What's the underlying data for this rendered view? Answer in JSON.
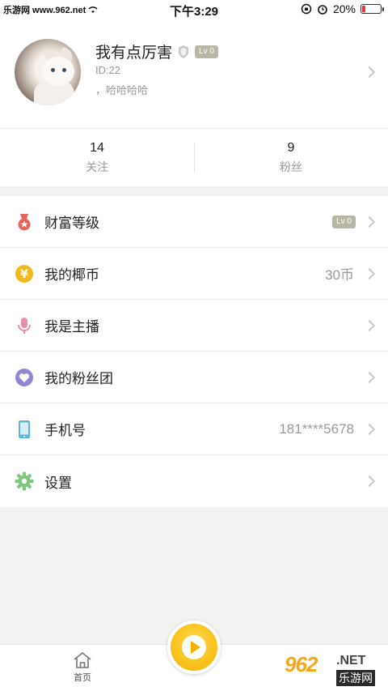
{
  "status_bar": {
    "carrier": "乐游网 www.962.net",
    "time": "下午3:29",
    "battery": "20%",
    "battery_level": 0.2
  },
  "profile": {
    "nickname": "我有点厉害",
    "level_badge": "Lv 0",
    "user_id": "ID:22",
    "signature": "，哈哈哈哈"
  },
  "stats": [
    {
      "value": "14",
      "label": "关注"
    },
    {
      "value": "9",
      "label": "粉丝"
    }
  ],
  "menu": [
    {
      "label": "财富等级",
      "badge": "Lv 0",
      "icon": "medal-icon",
      "color": "#e8645a"
    },
    {
      "label": "我的椰币",
      "value": "30币",
      "icon": "coin-icon",
      "color": "#f2b91c"
    },
    {
      "label": "我是主播",
      "icon": "microphone-icon",
      "color": "#e98fa8"
    },
    {
      "label": "我的粉丝团",
      "icon": "heart-icon",
      "color": "#8f86d6"
    },
    {
      "label": "手机号",
      "value": "181****5678",
      "icon": "phone-icon",
      "color": "#5ab7d8"
    },
    {
      "label": "设置",
      "icon": "gear-icon",
      "color": "#7cc97a"
    }
  ],
  "tabbar": {
    "home_label": "首页"
  },
  "watermark": {
    "number": "962",
    "net": ".NET",
    "site": "乐游网"
  }
}
